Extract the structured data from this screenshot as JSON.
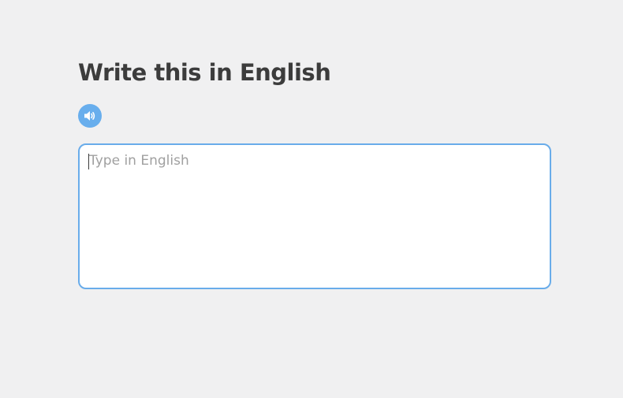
{
  "challenge": {
    "title": "Write this in English",
    "audio_button": {
      "icon": "speaker-icon",
      "color": "#68aeed"
    },
    "answer": {
      "value": "",
      "placeholder": "Type in English",
      "border_color": "#69acea"
    }
  }
}
